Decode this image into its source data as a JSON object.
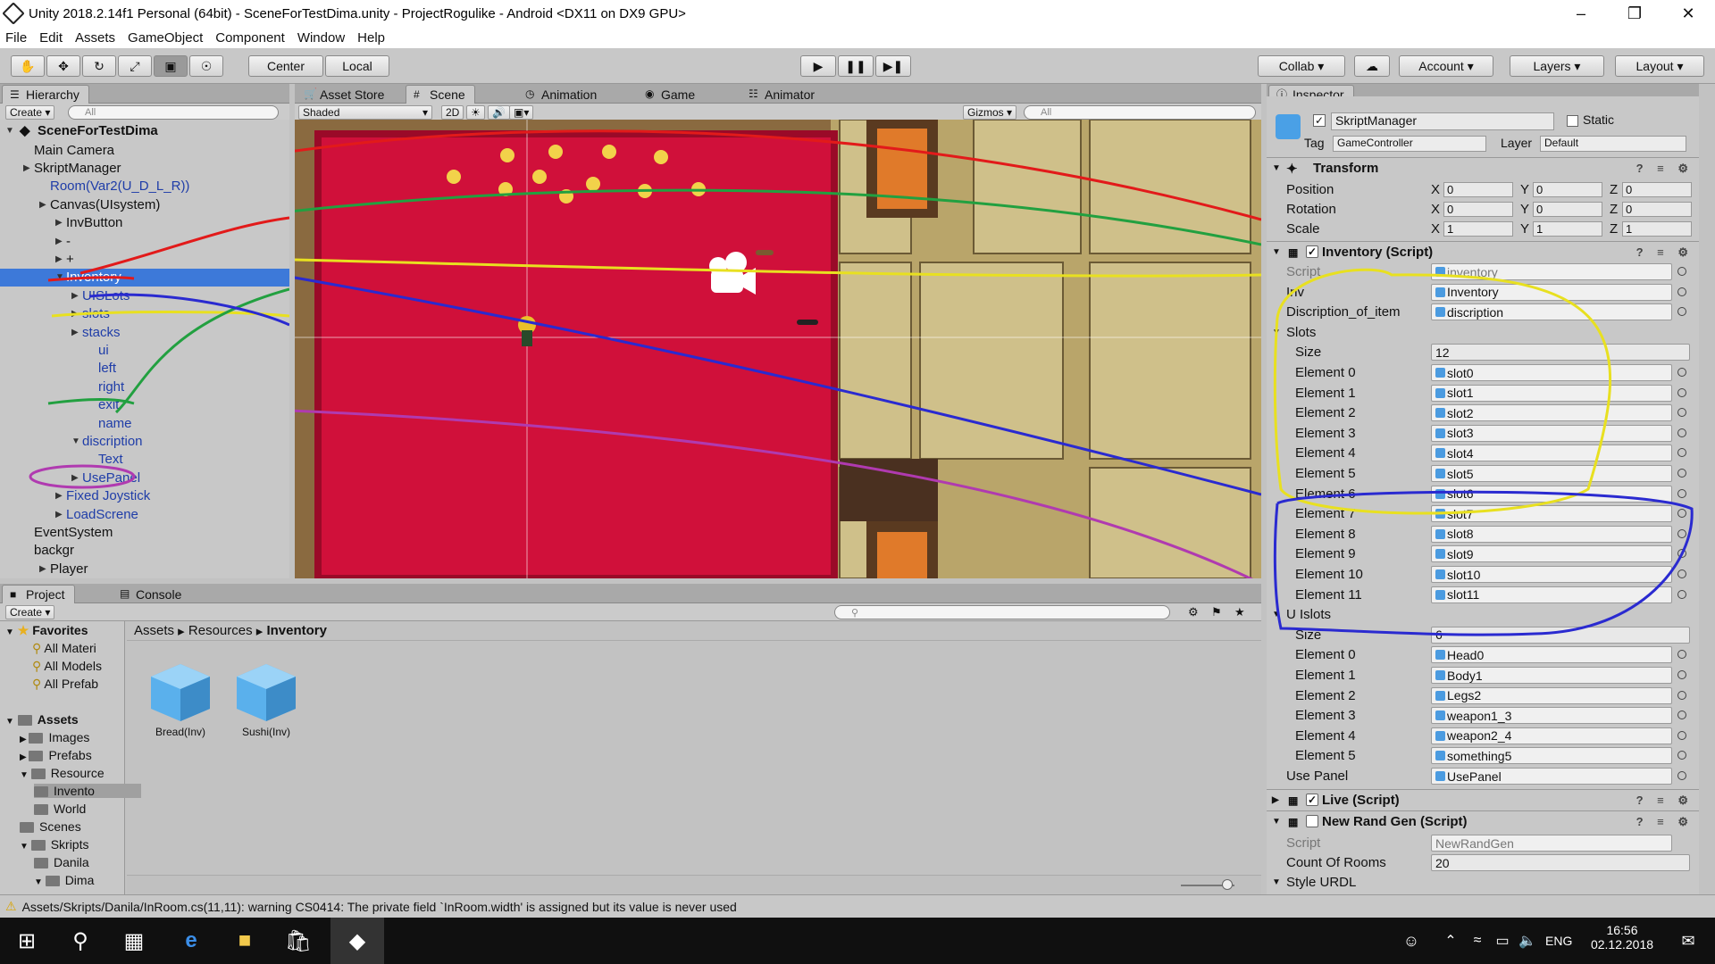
{
  "window": {
    "title": "Unity 2018.2.14f1 Personal (64bit) - SceneForTestDima.unity - ProjectRogulike - Android <DX11 on DX9 GPU>"
  },
  "menu": [
    "File",
    "Edit",
    "Assets",
    "GameObject",
    "Component",
    "Window",
    "Help"
  ],
  "toolbar": {
    "center": "Center",
    "local": "Local",
    "collab": "Collab",
    "account": "Account",
    "layers": "Layers",
    "layout": "Layout"
  },
  "tabs": {
    "hierarchy": "Hierarchy",
    "asset_store": "Asset Store",
    "scene": "Scene",
    "animation": "Animation",
    "game": "Game",
    "animator": "Animator",
    "inspector": "Inspector",
    "project": "Project",
    "console": "Console"
  },
  "hierarchy": {
    "create": "Create",
    "search_placeholder": "All",
    "scene_name": "SceneForTestDima",
    "items": [
      {
        "label": "Main Camera"
      },
      {
        "label": "SkriptManager"
      },
      {
        "label": "Room(Var2(U_D_L_R))"
      },
      {
        "label": "Canvas(UIsystem)"
      },
      {
        "label": "InvButton"
      },
      {
        "label": "-"
      },
      {
        "label": "+"
      },
      {
        "label": "Inventory"
      },
      {
        "label": "UISLots"
      },
      {
        "label": "slots"
      },
      {
        "label": "stacks"
      },
      {
        "label": "ui"
      },
      {
        "label": "left"
      },
      {
        "label": "right"
      },
      {
        "label": "exit"
      },
      {
        "label": "name"
      },
      {
        "label": "discription"
      },
      {
        "label": "Text"
      },
      {
        "label": "UsePanel"
      },
      {
        "label": "Fixed Joystick"
      },
      {
        "label": "LoadScrene"
      },
      {
        "label": "EventSystem"
      },
      {
        "label": "backgr"
      },
      {
        "label": "Player"
      }
    ]
  },
  "scene": {
    "shading": "Shaded",
    "mode_2d": "2D",
    "gizmos": "Gizmos",
    "search_placeholder": "All"
  },
  "inspector": {
    "object_name": "SkriptManager",
    "static_label": "Static",
    "tag_label": "Tag",
    "tag_value": "GameController",
    "layer_label": "Layer",
    "layer_value": "Default",
    "transform": {
      "title": "Transform",
      "position_label": "Position",
      "rotation_label": "Rotation",
      "scale_label": "Scale",
      "position": [
        "0",
        "0",
        "0"
      ],
      "rotation": [
        "0",
        "0",
        "0"
      ],
      "scale": [
        "1",
        "1",
        "1"
      ]
    },
    "inventory_script": {
      "title": "Inventory (Script)",
      "script_label": "Script",
      "script_value": "inventory",
      "inv_label": "Inv",
      "inv_value": "Inventory",
      "disc_label": "Discription_of_item",
      "disc_value": "discription",
      "slots_label": "Slots",
      "size_label": "Size",
      "slots_size": "12",
      "slots": [
        {
          "el": "Element 0",
          "val": "slot0"
        },
        {
          "el": "Element 1",
          "val": "slot1"
        },
        {
          "el": "Element 2",
          "val": "slot2"
        },
        {
          "el": "Element 3",
          "val": "slot3"
        },
        {
          "el": "Element 4",
          "val": "slot4"
        },
        {
          "el": "Element 5",
          "val": "slot5"
        },
        {
          "el": "Element 6",
          "val": "slot6"
        },
        {
          "el": "Element 7",
          "val": "slot7"
        },
        {
          "el": "Element 8",
          "val": "slot8"
        },
        {
          "el": "Element 9",
          "val": "slot9"
        },
        {
          "el": "Element 10",
          "val": "slot10"
        },
        {
          "el": "Element 11",
          "val": "slot11"
        }
      ],
      "uislots_label": "U Islots",
      "uislots_size": "6",
      "uislots": [
        {
          "el": "Element 0",
          "val": "Head0"
        },
        {
          "el": "Element 1",
          "val": "Body1"
        },
        {
          "el": "Element 2",
          "val": "Legs2"
        },
        {
          "el": "Element 3",
          "val": "weapon1_3"
        },
        {
          "el": "Element 4",
          "val": "weapon2_4"
        },
        {
          "el": "Element 5",
          "val": "something5"
        }
      ],
      "usepanel_label": "Use Panel",
      "usepanel_value": "UsePanel"
    },
    "live_script": {
      "title": "Live (Script)"
    },
    "randgen_script": {
      "title": "New Rand Gen (Script)",
      "script_label": "Script",
      "script_value": "NewRandGen",
      "count_label": "Count Of Rooms",
      "count_value": "20",
      "style_label": "Style URDL"
    }
  },
  "project": {
    "create": "Create",
    "breadcrumb": [
      "Assets",
      "Resources",
      "Inventory"
    ],
    "favorites_label": "Favorites",
    "favorites": [
      "All Materi",
      "All Models",
      "All Prefab"
    ],
    "assets_label": "Assets",
    "tree": [
      "Images",
      "Prefabs",
      "Resource",
      "Invento",
      "World",
      "Scenes",
      "Skripts",
      "Danila",
      "Dima"
    ],
    "files": [
      {
        "name": "Bread(Inv)"
      },
      {
        "name": "Sushi(Inv)"
      }
    ]
  },
  "status": {
    "warning": "Assets/Skripts/Danila/InRoom.cs(11,11): warning CS0414: The private field `InRoom.width' is assigned but its value is never used"
  },
  "taskbar": {
    "lang": "ENG",
    "time": "16:56",
    "date": "02.12.2018"
  }
}
